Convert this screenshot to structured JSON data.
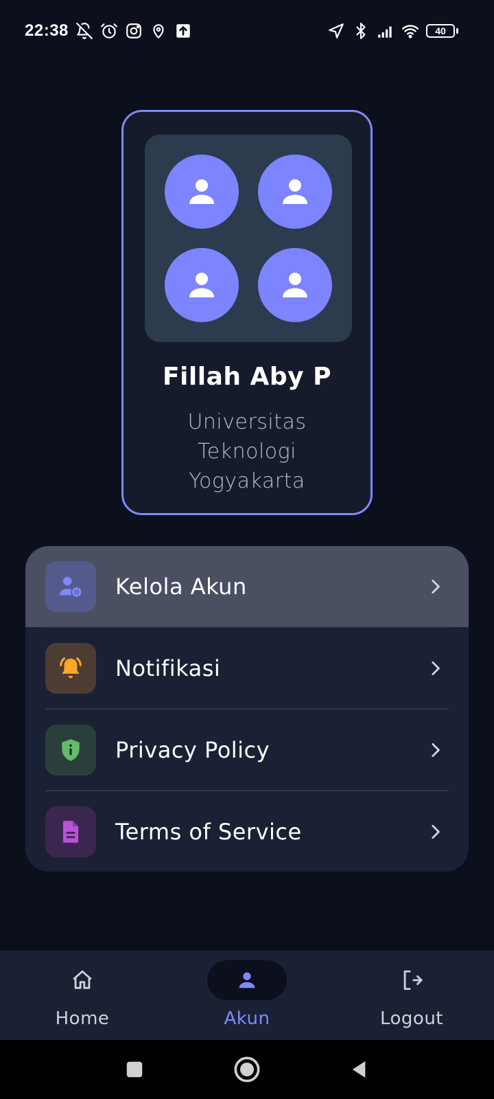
{
  "status_bar": {
    "time": "22:38",
    "battery_level": "40",
    "left_icons": [
      "bell-off-icon",
      "alarm-icon",
      "instagram-icon",
      "location-pin-icon",
      "upload-icon"
    ],
    "right_icons": [
      "navigation-icon",
      "bluetooth-icon",
      "signal-icon",
      "wifi-icon",
      "battery-icon"
    ]
  },
  "profile": {
    "name": "Fillah Aby P",
    "university": "Universitas Teknologi Yogyakarta",
    "avatar_icon": "person-icon",
    "avatar_count": 4
  },
  "menu": {
    "items": [
      {
        "label": "Kelola Akun",
        "icon": "user-gear-icon",
        "icon_color": "#8088ff",
        "icon_bg": "#555a8c",
        "active": true
      },
      {
        "label": "Notifikasi",
        "icon": "bell-ring-icon",
        "icon_color": "#ffa726",
        "icon_bg": "#4c3c33",
        "active": false
      },
      {
        "label": "Privacy Policy",
        "icon": "shield-info-icon",
        "icon_color": "#66bb6a",
        "icon_bg": "#2a3f3c",
        "active": false
      },
      {
        "label": "Terms of Service",
        "icon": "document-icon",
        "icon_color": "#ba52d6",
        "icon_bg": "#3b2650",
        "active": false
      }
    ]
  },
  "bottom_nav": {
    "items": [
      {
        "label": "Home",
        "icon": "home-icon",
        "active": false
      },
      {
        "label": "Akun",
        "icon": "person-icon",
        "active": true
      },
      {
        "label": "Logout",
        "icon": "logout-icon",
        "active": false
      }
    ]
  },
  "system_nav": {
    "buttons": [
      "recents-icon",
      "home-circle-icon",
      "back-icon"
    ]
  },
  "colors": {
    "background": "#0c0f1c",
    "card": "#1b2134",
    "accent": "#8088ff",
    "avatar": "#7c84ff"
  }
}
